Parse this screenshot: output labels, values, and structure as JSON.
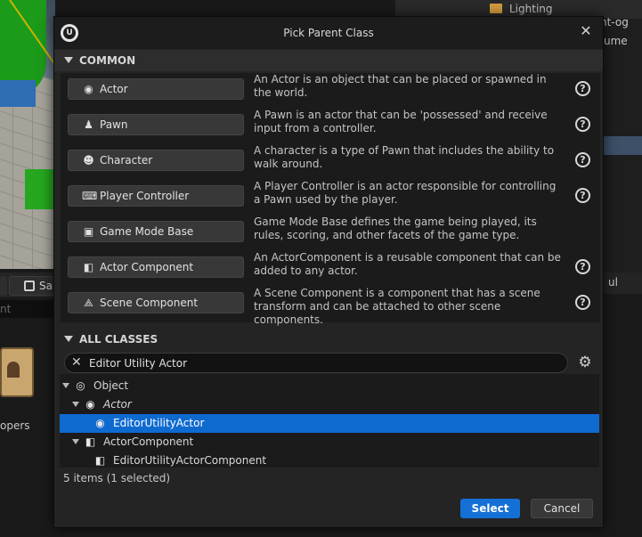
{
  "background": {
    "outliner": {
      "folder_label": "Lighting",
      "row1_text": "nt-og",
      "row2_text": "ume"
    },
    "toolbar": {
      "save_label": "Sa"
    },
    "search_text": "nt",
    "asset_label": "opers",
    "right_toolbar_text": "ul"
  },
  "dialog": {
    "title": "Pick Parent Class",
    "close_glyph": "✕",
    "logo_glyph": "U",
    "common_header": "COMMON",
    "all_classes_header": "ALL CLASSES",
    "common_classes": [
      {
        "label": "Actor",
        "icon": "actor-icon",
        "glyph": "◉",
        "desc": "An Actor is an object that can be placed or spawned in the world.",
        "help": true
      },
      {
        "label": "Pawn",
        "icon": "pawn-icon",
        "glyph": "♟",
        "desc": "A Pawn is an actor that can be 'possessed' and receive input from a controller.",
        "help": true
      },
      {
        "label": "Character",
        "icon": "character-icon",
        "glyph": "☻",
        "desc": "A character is a type of Pawn that includes the ability to walk around.",
        "help": true
      },
      {
        "label": "Player Controller",
        "icon": "gamepad-icon",
        "glyph": "⌨",
        "desc": "A Player Controller is an actor responsible for controlling a Pawn used by the player.",
        "help": true
      },
      {
        "label": "Game Mode Base",
        "icon": "game-mode-icon",
        "glyph": "▣",
        "desc": "Game Mode Base defines the game being played, its rules, scoring, and other facets of the game type.",
        "help": false
      },
      {
        "label": "Actor Component",
        "icon": "component-icon",
        "glyph": "◧",
        "desc": "An ActorComponent is a reusable component that can be added to any actor.",
        "help": true
      },
      {
        "label": "Scene Component",
        "icon": "scene-component-icon",
        "glyph": "⟁",
        "desc": "A Scene Component is a component that has a scene transform and can be attached to other scene components.",
        "help": true
      }
    ],
    "help_glyph": "?",
    "search": {
      "clear_glyph": "✕",
      "value": "Editor Utility Actor"
    },
    "settings_glyph": "⚙",
    "tree": [
      {
        "label": "Object",
        "icon": "object-icon",
        "glyph": "◎",
        "italic": false,
        "selected": false
      },
      {
        "label": "Actor",
        "icon": "actor-icon",
        "glyph": "◉",
        "italic": true,
        "selected": false
      },
      {
        "label": "EditorUtilityActor",
        "icon": "actor-icon",
        "glyph": "◉",
        "italic": false,
        "selected": true
      },
      {
        "label": "ActorComponent",
        "icon": "component-icon",
        "glyph": "◧",
        "italic": false,
        "selected": false
      },
      {
        "label": "EditorUtilityActorComponent",
        "icon": "component-icon",
        "glyph": "◧",
        "italic": false,
        "selected": false
      }
    ],
    "status": "5 items (1 selected)",
    "select_label": "Select",
    "cancel_label": "Cancel"
  },
  "colors": {
    "accent": "#1570d6",
    "selection": "#0f6ad0",
    "panel": "#242424",
    "panel_dark": "#1b1b1b"
  }
}
